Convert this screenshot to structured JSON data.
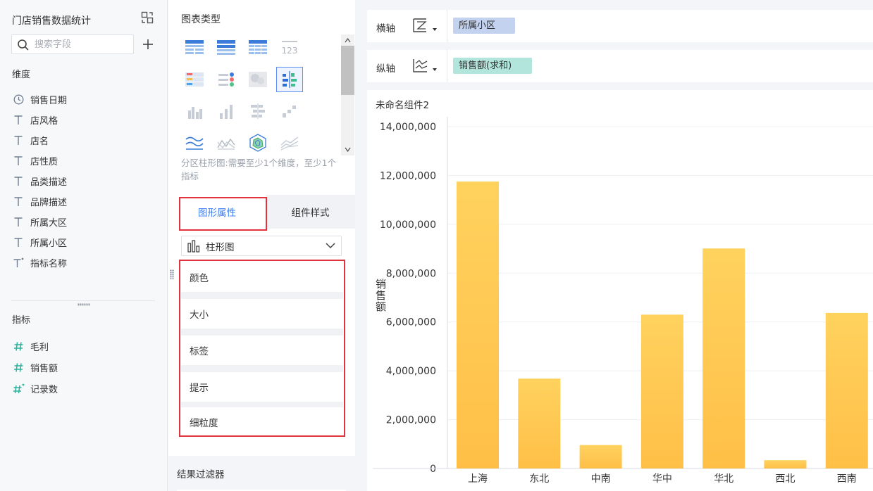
{
  "left_panel": {
    "dataset_title": "门店销售数据统计",
    "search_placeholder": "搜索字段",
    "dimension_title": "维度",
    "dimensions": [
      {
        "label": "销售日期",
        "icon": "clock-icon"
      },
      {
        "label": "店风格",
        "icon": "text-field-icon"
      },
      {
        "label": "店名",
        "icon": "text-field-icon"
      },
      {
        "label": "店性质",
        "icon": "text-field-icon"
      },
      {
        "label": "品类描述",
        "icon": "text-field-icon"
      },
      {
        "label": "品牌描述",
        "icon": "text-field-icon"
      },
      {
        "label": "所属大区",
        "icon": "text-field-icon"
      },
      {
        "label": "所属小区",
        "icon": "text-field-icon"
      },
      {
        "label": "指标名称",
        "icon": "text-calc-field-icon"
      }
    ],
    "measure_title": "指标",
    "measures": [
      {
        "label": "毛利",
        "icon": "number-field-icon"
      },
      {
        "label": "销售额",
        "icon": "number-field-icon"
      },
      {
        "label": "记录数",
        "icon": "number-calc-field-icon"
      }
    ]
  },
  "middle_panel": {
    "chart_type_title": "图表类型",
    "chart_description": "分区柱形图:需要至少1个维度，至少1个指标",
    "tabs": {
      "graph_props": "图形属性",
      "component_style": "组件样式"
    },
    "chart_select_value": "柱形图",
    "properties": [
      "颜色",
      "大小",
      "标签",
      "提示",
      "细粒度"
    ],
    "result_filter": "结果过滤器"
  },
  "right_panel": {
    "x_axis_label": "横轴",
    "y_axis_label": "纵轴",
    "x_field": "所属小区",
    "y_field": "销售额(求和)",
    "widget_title": "未命名组件2"
  },
  "colors": {
    "accent": "#3f7df0",
    "highlight_box": "#e2333f",
    "dimension_pill": "#c3d2ef",
    "measure_pill": "#b2e6dc",
    "bar_top": "#ffd25e",
    "bar_bottom": "#ffbf47"
  },
  "chart_data": {
    "type": "bar",
    "categories": [
      "上海",
      "东北",
      "中南",
      "华中",
      "华北",
      "西北",
      "西南"
    ],
    "values": [
      11750000,
      3680000,
      960000,
      6300000,
      9010000,
      340000,
      6370000
    ],
    "ylabel": "销售额",
    "ylim": [
      0,
      14000000
    ],
    "yticks": [
      0,
      2000000,
      4000000,
      6000000,
      8000000,
      10000000,
      12000000,
      14000000
    ],
    "ytick_labels": [
      "0",
      "2,000,000",
      "4,000,000",
      "6,000,000",
      "8,000,000",
      "10,000,000",
      "12,000,000",
      "14,000,000"
    ],
    "grid": true
  }
}
